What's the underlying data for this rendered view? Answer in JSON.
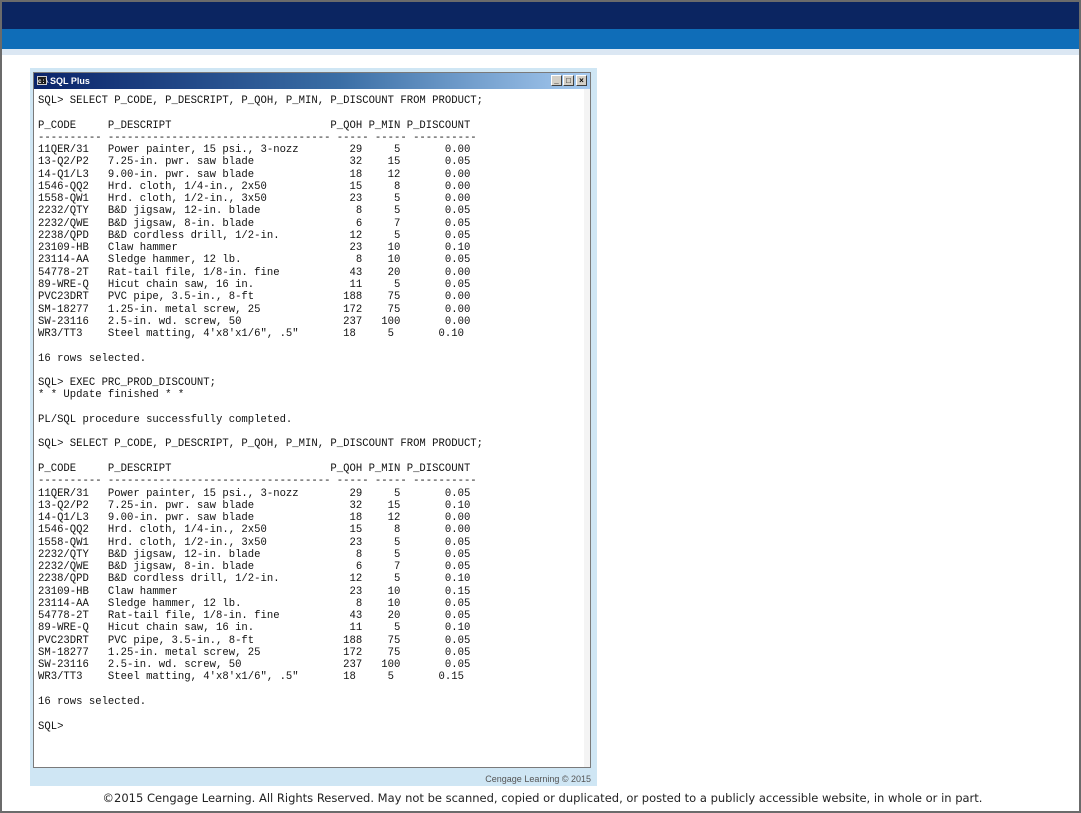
{
  "window": {
    "title": "SQL Plus",
    "title_icon": "c:\\",
    "minimize_symbol": "_",
    "maximize_symbol": "□",
    "close_symbol": "×"
  },
  "console": {
    "lines": [
      "SQL> SELECT P_CODE, P_DESCRIPT, P_QOH, P_MIN, P_DISCOUNT FROM PRODUCT;",
      "",
      "P_CODE     P_DESCRIPT                         P_QOH P_MIN P_DISCOUNT",
      "---------- ----------------------------------- ----- ----- ----------",
      "11QER/31   Power painter, 15 psi., 3-nozz        29     5       0.00",
      "13-Q2/P2   7.25-in. pwr. saw blade               32    15       0.05",
      "14-Q1/L3   9.00-in. pwr. saw blade               18    12       0.00",
      "1546-QQ2   Hrd. cloth, 1/4-in., 2x50             15     8       0.00",
      "1558-QW1   Hrd. cloth, 1/2-in., 3x50             23     5       0.00",
      "2232/QTY   B&D jigsaw, 12-in. blade               8     5       0.05",
      "2232/QWE   B&D jigsaw, 8-in. blade                6     7       0.05",
      "2238/QPD   B&D cordless drill, 1/2-in.           12     5       0.05",
      "23109-HB   Claw hammer                           23    10       0.10",
      "23114-AA   Sledge hammer, 12 lb.                  8    10       0.05",
      "54778-2T   Rat-tail file, 1/8-in. fine           43    20       0.00",
      "89-WRE-Q   Hicut chain saw, 16 in.               11     5       0.05",
      "PVC23DRT   PVC pipe, 3.5-in., 8-ft              188    75       0.00",
      "SM-18277   1.25-in. metal screw, 25             172    75       0.00",
      "SW-23116   2.5-in. wd. screw, 50                237   100       0.00",
      "WR3/TT3    Steel matting, 4'x8'x1/6\", .5\"       18     5       0.10",
      "",
      "16 rows selected.",
      "",
      "SQL> EXEC PRC_PROD_DISCOUNT;",
      "* * Update finished * *",
      "",
      "PL/SQL procedure successfully completed.",
      "",
      "SQL> SELECT P_CODE, P_DESCRIPT, P_QOH, P_MIN, P_DISCOUNT FROM PRODUCT;",
      "",
      "P_CODE     P_DESCRIPT                         P_QOH P_MIN P_DISCOUNT",
      "---------- ----------------------------------- ----- ----- ----------",
      "11QER/31   Power painter, 15 psi., 3-nozz        29     5       0.05",
      "13-Q2/P2   7.25-in. pwr. saw blade               32    15       0.10",
      "14-Q1/L3   9.00-in. pwr. saw blade               18    12       0.00",
      "1546-QQ2   Hrd. cloth, 1/4-in., 2x50             15     8       0.00",
      "1558-QW1   Hrd. cloth, 1/2-in., 3x50             23     5       0.05",
      "2232/QTY   B&D jigsaw, 12-in. blade               8     5       0.05",
      "2232/QWE   B&D jigsaw, 8-in. blade                6     7       0.05",
      "2238/QPD   B&D cordless drill, 1/2-in.           12     5       0.10",
      "23109-HB   Claw hammer                           23    10       0.15",
      "23114-AA   Sledge hammer, 12 lb.                  8    10       0.05",
      "54778-2T   Rat-tail file, 1/8-in. fine           43    20       0.05",
      "89-WRE-Q   Hicut chain saw, 16 in.               11     5       0.10",
      "PVC23DRT   PVC pipe, 3.5-in., 8-ft              188    75       0.05",
      "SM-18277   1.25-in. metal screw, 25             172    75       0.05",
      "SW-23116   2.5-in. wd. screw, 50                237   100       0.05",
      "WR3/TT3    Steel matting, 4'x8'x1/6\", .5\"       18     5       0.15",
      "",
      "16 rows selected.",
      "",
      "SQL>"
    ]
  },
  "footer": {
    "publisher_mark": "Cengage Learning © 2015",
    "copyright": "©2015 Cengage Learning. All Rights Reserved. May not be scanned, copied or duplicated, or posted to a publicly accessible website, in whole or in part."
  },
  "colors": {
    "banner_dark": "#0b2561",
    "banner_blue": "#0f6db8",
    "panel_background": "#cfe6f4",
    "titlebar_start": "#0a246a"
  },
  "icons": {
    "title_icon": "console-icon",
    "minimize": "minimize-icon",
    "maximize": "maximize-icon",
    "close": "close-icon"
  }
}
